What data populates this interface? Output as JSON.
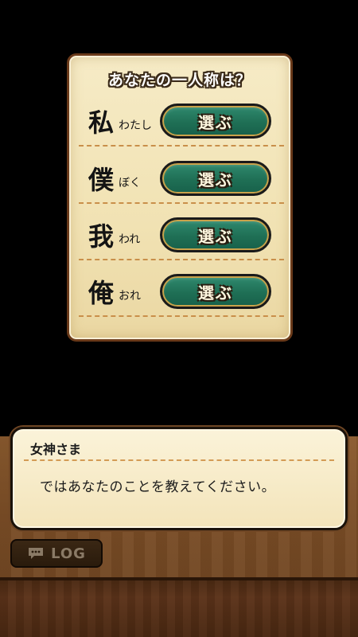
{
  "choice_panel": {
    "title": "あなたの一人称は？",
    "options": [
      {
        "kanji": "私",
        "reading": "わたし",
        "button_label": "選ぶ"
      },
      {
        "kanji": "僕",
        "reading": "ぼく",
        "button_label": "選ぶ"
      },
      {
        "kanji": "我",
        "reading": "われ",
        "button_label": "選ぶ"
      },
      {
        "kanji": "俺",
        "reading": "おれ",
        "button_label": "選ぶ"
      }
    ]
  },
  "dialogue": {
    "speaker": "女神さま",
    "text": "ではあなたのことを教えてください。"
  },
  "log_button": {
    "label": "LOG",
    "icon": "chat-bubble-icon"
  },
  "colors": {
    "button_green": "#1f6f55",
    "panel_cream": "#f3e4ba",
    "wood_brown": "#7a4d26"
  }
}
